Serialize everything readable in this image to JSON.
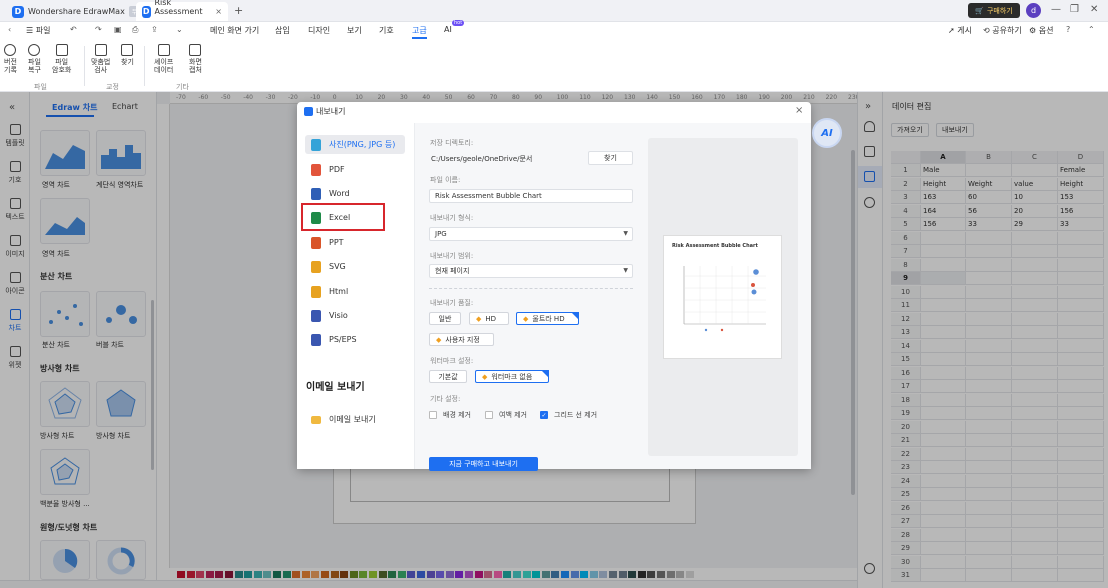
{
  "titlebar": {
    "app_name": "Wondershare EdrawMax",
    "app_badge": "무료",
    "doc_tab": "Risk Assessment ...",
    "new_tab": "+",
    "buy_button": "구매하기",
    "avatar_letter": "d"
  },
  "menubar": {
    "file": "파일",
    "items": [
      "메인 화면 가기",
      "삽입",
      "디자인",
      "보기",
      "기호",
      "고급",
      "AI"
    ],
    "ai_badge": "hot",
    "right": [
      "게시",
      "공유하기",
      "옵션"
    ]
  },
  "ribbon": {
    "buttons": [
      {
        "label": "버전\n기록"
      },
      {
        "label": "파일\n복구"
      },
      {
        "label": "파일\n암호화"
      },
      {
        "label": "맞춤법\n검사"
      },
      {
        "label": "찾기"
      },
      {
        "label": "셰이프\n데이터"
      },
      {
        "label": "화면\n캡처"
      }
    ],
    "groups": [
      "파일",
      "교정",
      "기타"
    ]
  },
  "rail": {
    "items": [
      "템플릿",
      "기호",
      "텍스트",
      "이미지",
      "아이콘",
      "차트",
      "위젯"
    ]
  },
  "library": {
    "tabs": [
      "Edraw 차트",
      "Echart"
    ],
    "thumbs": [
      {
        "label": "영역 차트"
      },
      {
        "label": "계단식 영역차트"
      },
      {
        "label": "영역 차트"
      }
    ],
    "section_scatter": "분산 차트",
    "thumbs_scatter": [
      {
        "label": "분산 차트"
      },
      {
        "label": "버블 차트"
      }
    ],
    "section_radar": "방사형 차트",
    "thumbs_radar": [
      {
        "label": "방사형 차트"
      },
      {
        "label": "방사형 차트"
      },
      {
        "label": "백분율 방사형 ..."
      }
    ],
    "section_pie": "원형/도넛형 차트"
  },
  "ruler": {
    "ticks": [
      "-70",
      "-60",
      "-50",
      "-40",
      "-30",
      "-20",
      "-10",
      "0",
      "10",
      "20",
      "30",
      "40",
      "50",
      "60",
      "70",
      "80",
      "90",
      "100",
      "110",
      "120",
      "130",
      "140",
      "150",
      "160",
      "170",
      "180",
      "190",
      "200",
      "210",
      "220",
      "230"
    ]
  },
  "datapanel": {
    "title": "데이터 편집",
    "import_btn": "가져오기",
    "export_btn": "내보내기",
    "columns": [
      "A",
      "B",
      "C",
      "D"
    ],
    "rows": [
      [
        "Male",
        "",
        "",
        "Female"
      ],
      [
        "Height",
        "Weight",
        "value",
        "Height"
      ],
      [
        "163",
        "60",
        "10",
        "153"
      ],
      [
        "164",
        "56",
        "20",
        "156"
      ],
      [
        "156",
        "33",
        "29",
        "33"
      ]
    ],
    "row_numbers": [
      "1",
      "2",
      "3",
      "4",
      "5",
      "6",
      "7",
      "8",
      "9",
      "10",
      "11",
      "12",
      "13",
      "14",
      "15",
      "16",
      "17",
      "18",
      "19",
      "20",
      "21",
      "22",
      "23",
      "24",
      "25",
      "26",
      "27",
      "28",
      "29",
      "30",
      "31"
    ]
  },
  "dialog": {
    "title": "내보내기",
    "formats": [
      {
        "label": "사진(PNG, JPG 등)",
        "color": "#35a3d8"
      },
      {
        "label": "PDF",
        "color": "#e2543b"
      },
      {
        "label": "Word",
        "color": "#2f5fb6"
      },
      {
        "label": "Excel",
        "color": "#1e8a48"
      },
      {
        "label": "PPT",
        "color": "#d9552a"
      },
      {
        "label": "SVG",
        "color": "#e7a220"
      },
      {
        "label": "Html",
        "color": "#e7a220"
      },
      {
        "label": "Visio",
        "color": "#3a56b0"
      },
      {
        "label": "PS/EPS",
        "color": "#3a56b0"
      }
    ],
    "email_header": "이메일 보내기",
    "email_item": "이메일 보내기",
    "save_dir_label": "저장 디렉토리:",
    "save_dir_value": "C:/Users/geole/OneDrive/문서",
    "browse_btn": "찾기",
    "filename_label": "파일 이름:",
    "filename_value": "Risk Assessment Bubble Chart",
    "format_label": "내보내기 형식:",
    "format_value": "JPG",
    "range_label": "내보내기 범위:",
    "range_value": "현재 페이지",
    "quality_label": "내보내기 품질:",
    "quality_options": [
      "일반",
      "HD",
      "울트라 HD"
    ],
    "custom_btn": "사용자 지정",
    "watermark_label": "워터마크 설정:",
    "watermark_options": [
      "기본값",
      "워터마크 없음"
    ],
    "other_label": "기타 설정:",
    "other_options": [
      {
        "label": "배경 제거",
        "checked": false
      },
      {
        "label": "여백 제거",
        "checked": false
      },
      {
        "label": "그리드 선 제거",
        "checked": true
      }
    ],
    "export_btn": "지금 구매하고 내보내기",
    "preview_title": "Risk Assessment Bubble Chart",
    "close": "×"
  },
  "colors": {
    "accent": "#1e6ff1",
    "highlight_box": "#d7262c"
  },
  "palette": [
    "#c8102e",
    "#d4213d",
    "#e0466b",
    "#c0245c",
    "#a81b4b",
    "#8c1639",
    "#2a8c8c",
    "#20a0a0",
    "#3cb4b4",
    "#6cc4c4",
    "#1a7a5e",
    "#22946e",
    "#e0702a",
    "#f08a3a",
    "#f4a460",
    "#d2691e",
    "#b5651d",
    "#8b4513",
    "#6b8e23",
    "#7cba3a",
    "#9acd32",
    "#556b2f",
    "#2e8b57",
    "#3cb371",
    "#5a5fd0",
    "#4169e1",
    "#6a5acd",
    "#7b68ee",
    "#9370db",
    "#8a2be2",
    "#ba55d3",
    "#c71585",
    "#db7093",
    "#ff69b4",
    "#20b2aa",
    "#48d1cc",
    "#40e0d0",
    "#00ced1",
    "#5f9ea0",
    "#4682b4",
    "#1e90ff",
    "#6495ed",
    "#00bfff",
    "#87ceeb",
    "#b0c4de",
    "#778899",
    "#708090",
    "#2f4f4f",
    "#333333",
    "#555555",
    "#777777",
    "#999999",
    "#bbbbbb",
    "#dddddd"
  ]
}
